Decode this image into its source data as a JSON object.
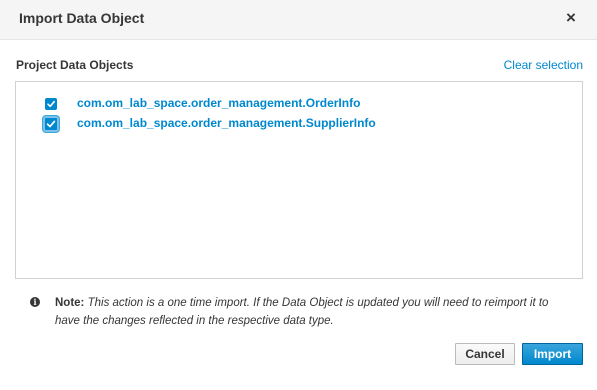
{
  "dialog": {
    "title": "Import Data Object",
    "close_icon": "close-icon",
    "close_glyph": "×"
  },
  "section": {
    "label": "Project Data Objects",
    "clear_link": "Clear selection"
  },
  "objects": [
    {
      "label": "com.om_lab_space.order_management.OrderInfo",
      "checked": true
    },
    {
      "label": "com.om_lab_space.order_management.SupplierInfo",
      "checked": true
    }
  ],
  "note": {
    "icon": "info-icon",
    "icon_glyph": "i",
    "prefix": "Note:",
    "text": "This action is a one time import. If the Data Object is updated you will need to reimport it to have the changes reflected in the respective data type."
  },
  "buttons": {
    "cancel": "Cancel",
    "import": "Import"
  },
  "colors": {
    "accent": "#0088ce",
    "header_bg": "#f5f5f5"
  }
}
